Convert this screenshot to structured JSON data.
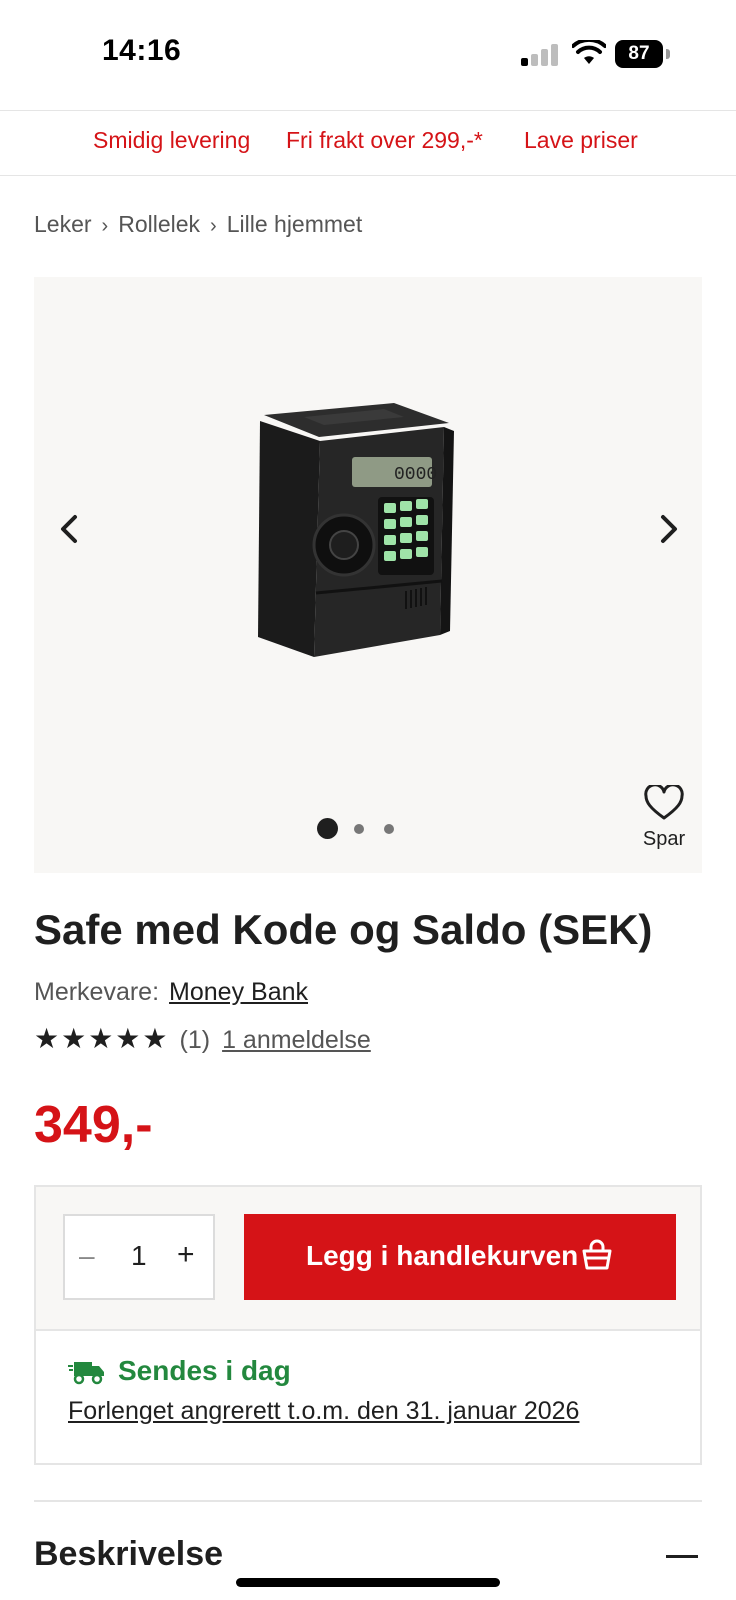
{
  "status": {
    "time": "14:16",
    "battery": "87"
  },
  "promo": [
    "Smidig levering",
    "Fri frakt over 299,-*",
    "Lave priser"
  ],
  "breadcrumb": [
    "Leker",
    "Rollelek",
    "Lille hjemmet"
  ],
  "gallery": {
    "save_label": "Spar",
    "image_count": 3,
    "active_index": 0
  },
  "product": {
    "title": "Safe med Kode og Saldo (SEK)",
    "brand_label": "Merkevare:",
    "brand": "Money Bank",
    "stars": "★★★★★",
    "rating_count": "(1)",
    "reviews_link": "1 anmeldelse",
    "price": "349,-"
  },
  "purchase": {
    "quantity": "1",
    "minus": "–",
    "plus": "+",
    "add_to_cart": "Legg i handlekurven",
    "shipping": "Sendes i dag",
    "return_policy": "Forlenget angrerett t.o.m. den 31. januar 2026"
  },
  "sections": {
    "description": "Beskrivelse"
  },
  "colors": {
    "accent": "#d51317",
    "success": "#23883e",
    "panel": "#f8f7f5"
  }
}
